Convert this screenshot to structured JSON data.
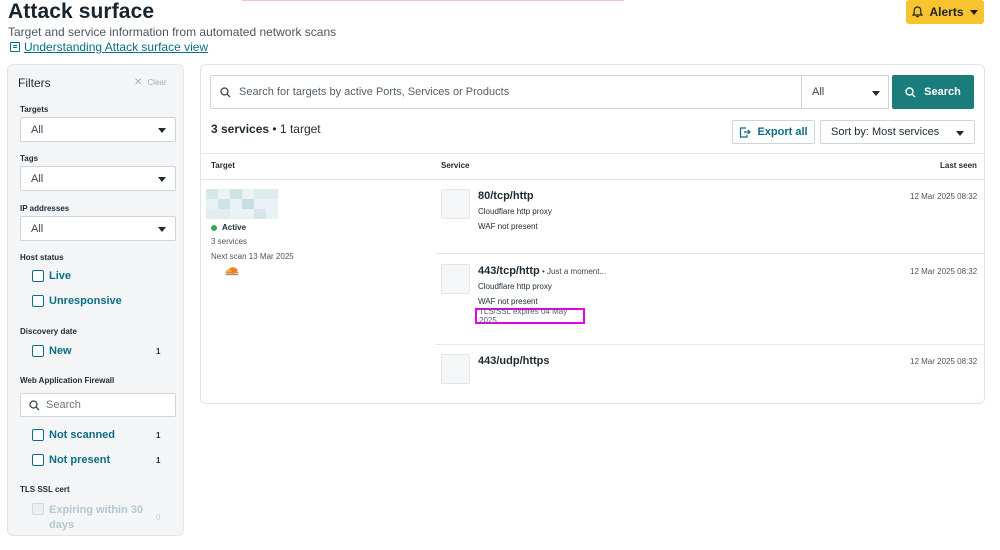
{
  "header": {
    "title": "Attack surface",
    "subtitle": "Target and service information from automated network scans",
    "help_link": "Understanding Attack surface view",
    "alerts_label": "Alerts"
  },
  "filters": {
    "title": "Filters",
    "clear_label": "Clear",
    "targets": {
      "label": "Targets",
      "value": "All"
    },
    "tags": {
      "label": "Tags",
      "value": "All"
    },
    "ip_addresses": {
      "label": "IP addresses",
      "value": "All"
    },
    "host_status": {
      "label": "Host status",
      "options": [
        "Live",
        "Unresponsive"
      ]
    },
    "discovery_date": {
      "label": "Discovery date",
      "option": "New",
      "count": "1"
    },
    "waf": {
      "label": "Web Application Firewall",
      "search_placeholder": "Search",
      "options": [
        {
          "label": "Not scanned",
          "count": "1"
        },
        {
          "label": "Not present",
          "count": "1"
        }
      ]
    },
    "tls": {
      "label": "TLS SSL cert",
      "option": "Expiring within 30 days",
      "count": "0"
    }
  },
  "main": {
    "search_placeholder": "Search for targets by active Ports, Services or Products",
    "scope_value": "All",
    "search_button": "Search",
    "summary_count": "3 services",
    "summary_rest": " • 1 target",
    "export_label": "Export all",
    "sort_label": "Sort by: Most services",
    "columns": {
      "target": "Target",
      "service": "Service",
      "last_seen": "Last seen"
    },
    "target": {
      "status": "Active",
      "services": "3 services",
      "next_scan": "Next scan 13 Mar 2025",
      "logo_text": "CLOUDFLARE"
    },
    "services": [
      {
        "name": "80/tcp/http",
        "extra": "",
        "lines": [
          "Cloudflare http proxy",
          "WAF not present"
        ],
        "last_seen": "12 Mar 2025 08:32"
      },
      {
        "name": "443/tcp/http",
        "extra": " • Just a moment...",
        "lines": [
          "Cloudflare http proxy",
          "WAF not present"
        ],
        "tls": "TLS/SSL expires 04 May 2025",
        "last_seen": "12 Mar 2025 08:32"
      },
      {
        "name": "443/udp/https",
        "extra": "",
        "lines": [],
        "last_seen": "12 Mar 2025 08:32"
      }
    ]
  },
  "colors": {
    "accent": "#1a7d7c",
    "link": "#0b6e86",
    "alert": "#f7c32e",
    "highlight": "#e600e6",
    "status_active": "#3aa657"
  }
}
